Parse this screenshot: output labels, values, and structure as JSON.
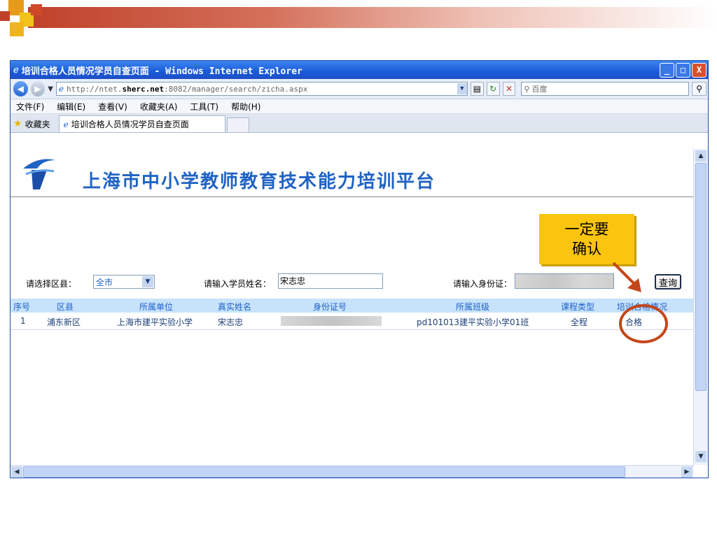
{
  "window": {
    "title": "培训合格人员情况学员自查页面 - Windows Internet Explorer",
    "minimize": "_",
    "maximize": "□",
    "close": "X"
  },
  "address_bar": {
    "url_scheme": "http://ntet.",
    "url_host": "sherc.net",
    "url_path": ":8082/manager/search/zicha.aspx",
    "search_placeholder": "百度"
  },
  "menu": {
    "items": [
      "文件(F)",
      "编辑(E)",
      "查看(V)",
      "收藏夹(A)",
      "工具(T)",
      "帮助(H)"
    ]
  },
  "tabs": {
    "favorites_label": "收藏夹",
    "active_tab": "培训合格人员情况学员自查页面"
  },
  "site": {
    "title": "上海市中小学教师教育技术能力培训平台"
  },
  "form": {
    "district_label": "请选择区县：",
    "district_value": "全市",
    "name_label": "请输入学员姓名：",
    "name_value": "宋志忠",
    "id_label": "请输入身份证：",
    "query_button": "查询"
  },
  "table": {
    "headers": [
      "序号",
      "区县",
      "所属单位",
      "真实姓名",
      "身份证号",
      "所属班级",
      "课程类型",
      "培训合格情况"
    ],
    "rows": [
      {
        "index": "1",
        "district": "浦东新区",
        "unit": "上海市建平实验小学",
        "name": "宋志忠",
        "id": "",
        "class": "pd101013建平实验小学01班",
        "course": "全程",
        "status": "合格"
      }
    ]
  },
  "annotation": {
    "line1": "一定要",
    "line2": "确认",
    "color": "#fbc50f"
  },
  "colors": {
    "accent": "#1f63c4",
    "banner": "#c0412a",
    "ring": "#c4471a"
  }
}
